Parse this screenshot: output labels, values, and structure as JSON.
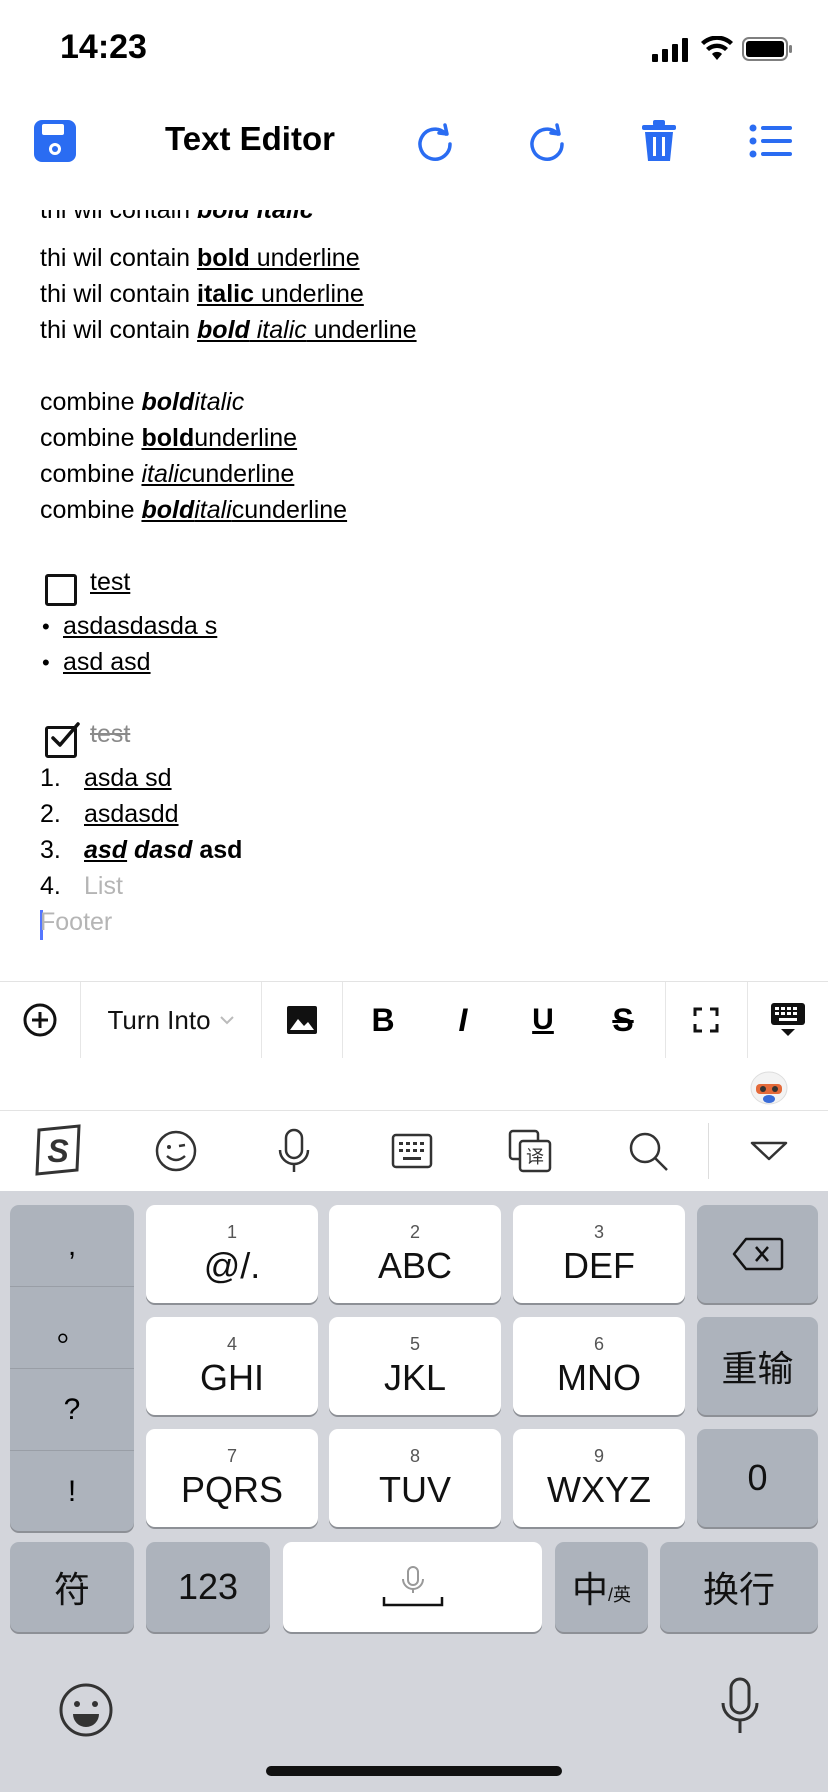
{
  "status": {
    "time": "14:23"
  },
  "header": {
    "title": "Text Editor",
    "icons": [
      "save-icon",
      "undo-icon",
      "redo-icon",
      "trash-icon",
      "list-icon"
    ],
    "accent": "#2a6cf2"
  },
  "editor": {
    "cut_line": {
      "prefix": "thi wil contain ",
      "bold_italic": "bold italic"
    },
    "lines": [
      {
        "prefix": "thi wil contain ",
        "a": "bold",
        "b": " underline"
      },
      {
        "prefix": "thi wil contain ",
        "a": "italic",
        "b": " underline"
      },
      {
        "prefix": "thi wil contain ",
        "a": "bold",
        "mid": " italic",
        "b": " underline"
      }
    ],
    "combine": {
      "word": "combine ",
      "l1": {
        "a": "bold",
        "b": "italic"
      },
      "l2": {
        "a": "bold",
        "b": "underline"
      },
      "l3": {
        "a": "italic",
        "b": "underline"
      },
      "l4": {
        "a": "bold",
        "b": "itali",
        "c": "cunderline"
      }
    },
    "todo_unchecked": "test",
    "bullets": [
      "asdasdasda s",
      "asd asd"
    ],
    "todo_checked": "test",
    "numbered": [
      {
        "n": "1.",
        "text": "asda sd"
      },
      {
        "n": "2.",
        "text": "asdasdd"
      },
      {
        "n": "3.",
        "a": "asd",
        "b": " dasd",
        "c": " asd"
      },
      {
        "n": "4.",
        "placeholder": "List"
      }
    ],
    "footer_placeholder": "Footer"
  },
  "toolbar": {
    "turn_into": "Turn Into",
    "bold": "B",
    "italic": "I",
    "underline": "U",
    "strike": "S"
  },
  "keyboard": {
    "side": [
      ",",
      "。",
      "?",
      "!"
    ],
    "keys": [
      {
        "num": "1",
        "label": "@/."
      },
      {
        "num": "2",
        "label": "ABC"
      },
      {
        "num": "3",
        "label": "DEF"
      },
      {
        "num": "4",
        "label": "GHI"
      },
      {
        "num": "5",
        "label": "JKL"
      },
      {
        "num": "6",
        "label": "MNO"
      },
      {
        "num": "7",
        "label": "PQRS"
      },
      {
        "num": "8",
        "label": "TUV"
      },
      {
        "num": "9",
        "label": "WXYZ"
      }
    ],
    "reset": "重输",
    "zero": "0",
    "symbols": "符",
    "num123": "123",
    "lang_main": "中",
    "lang_sub": "/英",
    "enter": "换行"
  }
}
